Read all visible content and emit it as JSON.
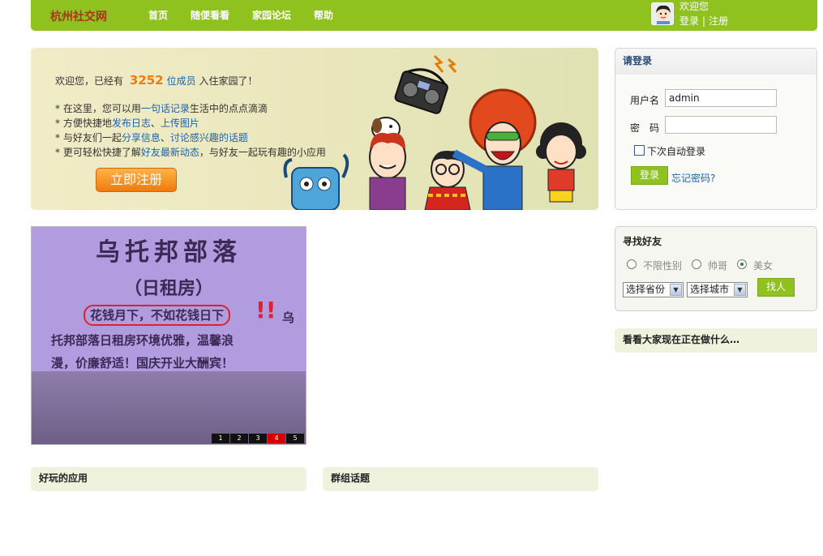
{
  "header": {
    "logo": "杭州社交网",
    "nav": [
      "首页",
      "随便看看",
      "家园论坛",
      "帮助"
    ],
    "welcome": "欢迎您",
    "login_link": "登录",
    "separator": "|",
    "register_link": "注册",
    "bar_color": "#8fc21f"
  },
  "banner": {
    "welcome_prefix": "欢迎您，已经有",
    "member_count": "3252",
    "member_unit": "位成员",
    "welcome_suffix": "入住家园了！",
    "features": [
      {
        "pre": "* 在这里，您可以用",
        "link1": "一句话记录",
        "mid": "生活中的点点滴滴",
        "link2": "",
        "post": ""
      },
      {
        "pre": "* 方便快捷地",
        "link1": "发布日志",
        "mid": "、",
        "link2": "上传图片",
        "post": ""
      },
      {
        "pre": "* 与好友们一起",
        "link1": "分享信息",
        "mid": "、",
        "link2": "讨论感兴趣的话题",
        "post": ""
      },
      {
        "pre": "* 更可轻松快捷了解",
        "link1": "好友最新动态",
        "mid": "，与好友一起玩有趣的小应用",
        "link2": "",
        "post": ""
      }
    ],
    "register_button": "立即注册"
  },
  "login": {
    "title": "请登录",
    "username_label": "用户名",
    "username_value": "admin",
    "password_label": "密　码",
    "remember_label": "下次自动登录",
    "login_button": "登录",
    "forgot_link": "忘记密码?"
  },
  "find_friends": {
    "title": "寻找好友",
    "options": [
      "不限性别",
      "帅哥",
      "美女"
    ],
    "selected_option": "美女",
    "province_select": "选择省份",
    "city_select": "选择城市",
    "find_button": "找人"
  },
  "happening": {
    "title": "看看大家现在正在做什么…"
  },
  "slideshow": {
    "title": "乌托邦部落",
    "subtitle": "（日租房）",
    "slogan": "花钱月下，不如花钱日下",
    "body_line1": "乌",
    "body_line2": "托邦部落日租房环境优雅，温馨浪",
    "body_line3": "漫，价廉舒适！国庆开业大酬宾！",
    "pages": [
      "1",
      "2",
      "3",
      "4",
      "5"
    ],
    "active_page": "4"
  },
  "sections": {
    "apps": "好玩的应用",
    "groups": "群组话题"
  }
}
